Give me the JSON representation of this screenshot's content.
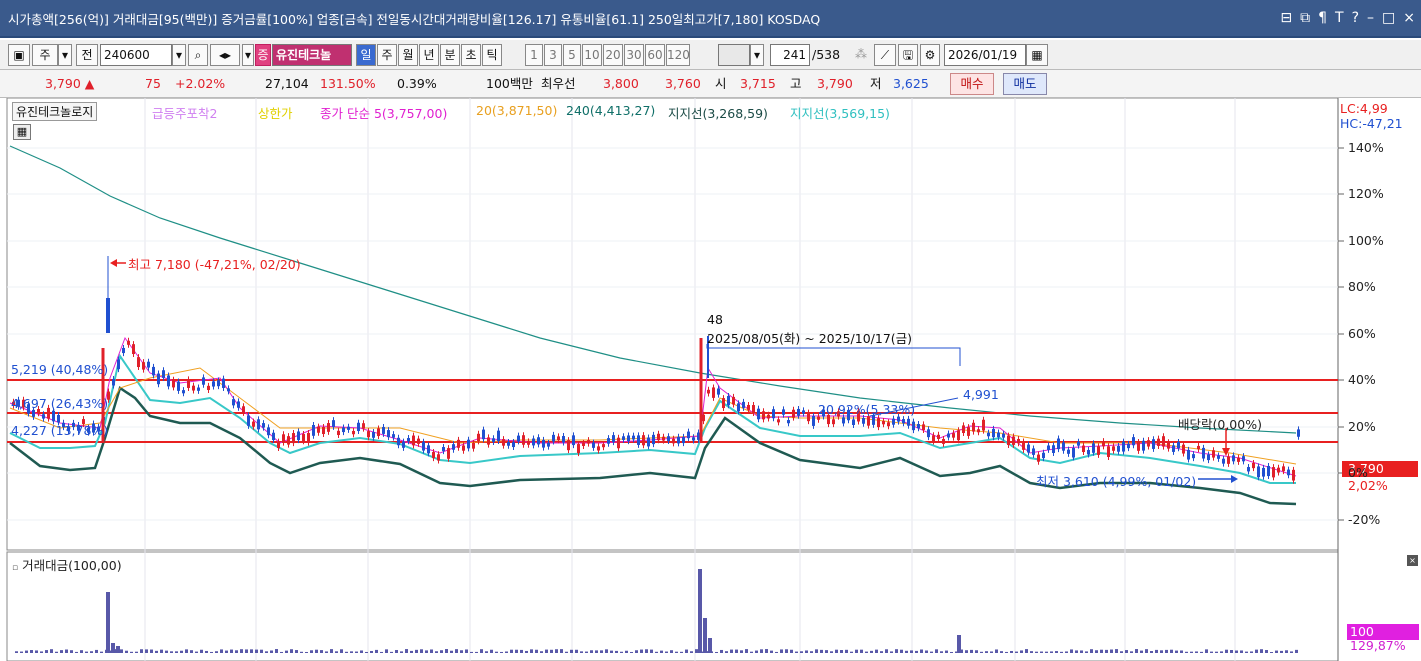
{
  "titlebar": {
    "info": "시가총액[256(억)]  거래대금[95(백만)]  증거금률[100%]  업종[금속]  전일동시간대거래량비율[126.17]  유통비율[61.1]  250일최고가[7,180]  KOSDAQ",
    "icons": [
      "minimize-pane-icon",
      "restore-pane-icon",
      "pin-icon",
      "font-icon",
      "help-icon",
      "minimize-icon",
      "maximize-icon",
      "close-icon"
    ]
  },
  "toolbar": {
    "btn_ju": "주",
    "btn_jeon": "전",
    "code": "240600",
    "search_icon": "🔍",
    "btn_jeung": "증",
    "stock_name": "유진테크놀",
    "periods": [
      "일",
      "주",
      "월",
      "년",
      "분",
      "초",
      "틱"
    ],
    "active_period": "일",
    "intervals": [
      "1",
      "3",
      "5",
      "10",
      "20",
      "30",
      "60",
      "120"
    ],
    "count": "241",
    "total": "/538",
    "date": "2026/01/19"
  },
  "infobar": {
    "price": "3,790",
    "arrow": "▲",
    "change": "75",
    "change_pct": "+2.02%",
    "volume": "27,104",
    "vol_ratio": "131.50%",
    "turnover": "0.39%",
    "unit": "100백만",
    "bid_label": "최우선",
    "best_ask": "3,800",
    "best_bid": "3,760",
    "open_label": "시",
    "open": "3,715",
    "high_label": "고",
    "high": "3,790",
    "low_label": "저",
    "low": "3,625",
    "buy_label": "매수",
    "sell_label": "매도"
  },
  "legend": {
    "stock": "유진테크놀로지",
    "indicator1": "급등주포착2",
    "indicator2": "상한가",
    "ma5": "종가 단순 5(3,757,00)",
    "ma20": "20(3,871,50)",
    "ma240": "240(4,413,27)",
    "support1": "지지선(3,268,59)",
    "support2": "지지선(3,569,15)",
    "lc": "LC:4,99",
    "hc": "HC:-47,21"
  },
  "annotations": {
    "high": "최고 7,180 (-47,21%, 02/20)",
    "low": "최저 3,610 (4,99%, 01/02)",
    "range_count": "48",
    "range_dates": "2025/08/05(화) ~ 2025/10/17(금)",
    "level1": "5,219 (40,48%)",
    "level2": "4,697 (26,43%)",
    "level3": "4,227 (13,78%)",
    "peak_label": "4,991",
    "pct_label": "20,92%(5,33%)",
    "dividend": "배당락(0,00%)",
    "price_tag": "3,790",
    "price_tag_pct": "2,02%"
  },
  "yaxis": [
    "140%",
    "120%",
    "100%",
    "80%",
    "60%",
    "40%",
    "20%",
    "0%",
    "-20%"
  ],
  "volume_panel": {
    "title": "거래대금(100,00)",
    "tag_value": "100",
    "tag_pct": "129,87%"
  },
  "colors": {
    "title_bg": "#3a5a8c",
    "up": "#e0202a",
    "down": "#2050d0",
    "ma240": "#1f8f86",
    "support_dark": "#1f5a52",
    "support_light": "#38c8c8",
    "ma20": "#f0a020",
    "ma5": "#e020d0",
    "hline": "#e82020"
  }
}
